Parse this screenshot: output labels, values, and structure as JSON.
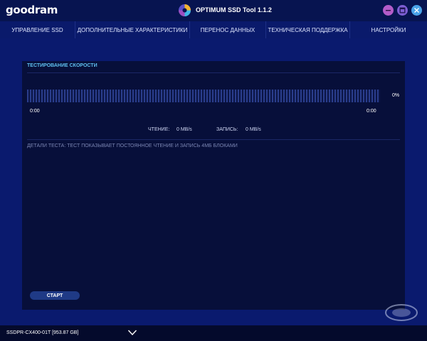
{
  "header": {
    "logo": "goodram",
    "app_title": "OPTIMUM SSD Tool 1.1.2"
  },
  "nav": {
    "items": [
      "УПРАВЛЕНИЕ SSD",
      "ДОПОЛНИТЕЛЬНЫЕ ХАРАКТЕРИСТИКИ",
      "ПЕРЕНОС ДАННЫХ",
      "ТЕХНИЧЕСКАЯ ПОДДЕРЖКА",
      "НАСТРОЙКИ"
    ]
  },
  "panel": {
    "title": "ТЕСТИРОВАНИЕ СКОРОСТИ",
    "progress_percent": "0%",
    "time_start": "0:00",
    "time_end": "0:00",
    "read_label": "ЧТЕНИЕ:",
    "read_value": "0  MB/s",
    "write_label": "ЗАПИСЬ:",
    "write_value": "0 MB/s",
    "details": "ДЕТАЛИ ТЕСТА: ТЕСТ ПОКАЗЫВАЕТ ПОСТОЯННОЕ ЧТЕНИЕ И ЗАПИСЬ 4МБ БЛОКАМИ",
    "start_label": "СТАРТ"
  },
  "footer": {
    "drive": "SSDPR-CX400-01T [953.87 GB]"
  },
  "colors": {
    "accent": "#5fc0f0",
    "background": "#0a1a6e",
    "panel": "#070f3a",
    "minimize": "#b35cc9",
    "maximize": "#7d5fd4",
    "close": "#4aa3e8"
  },
  "icons": [
    "app-logo-icon",
    "minimize-icon",
    "maximize-icon",
    "close-icon",
    "chevron-down-icon",
    "watermark-icon"
  ]
}
